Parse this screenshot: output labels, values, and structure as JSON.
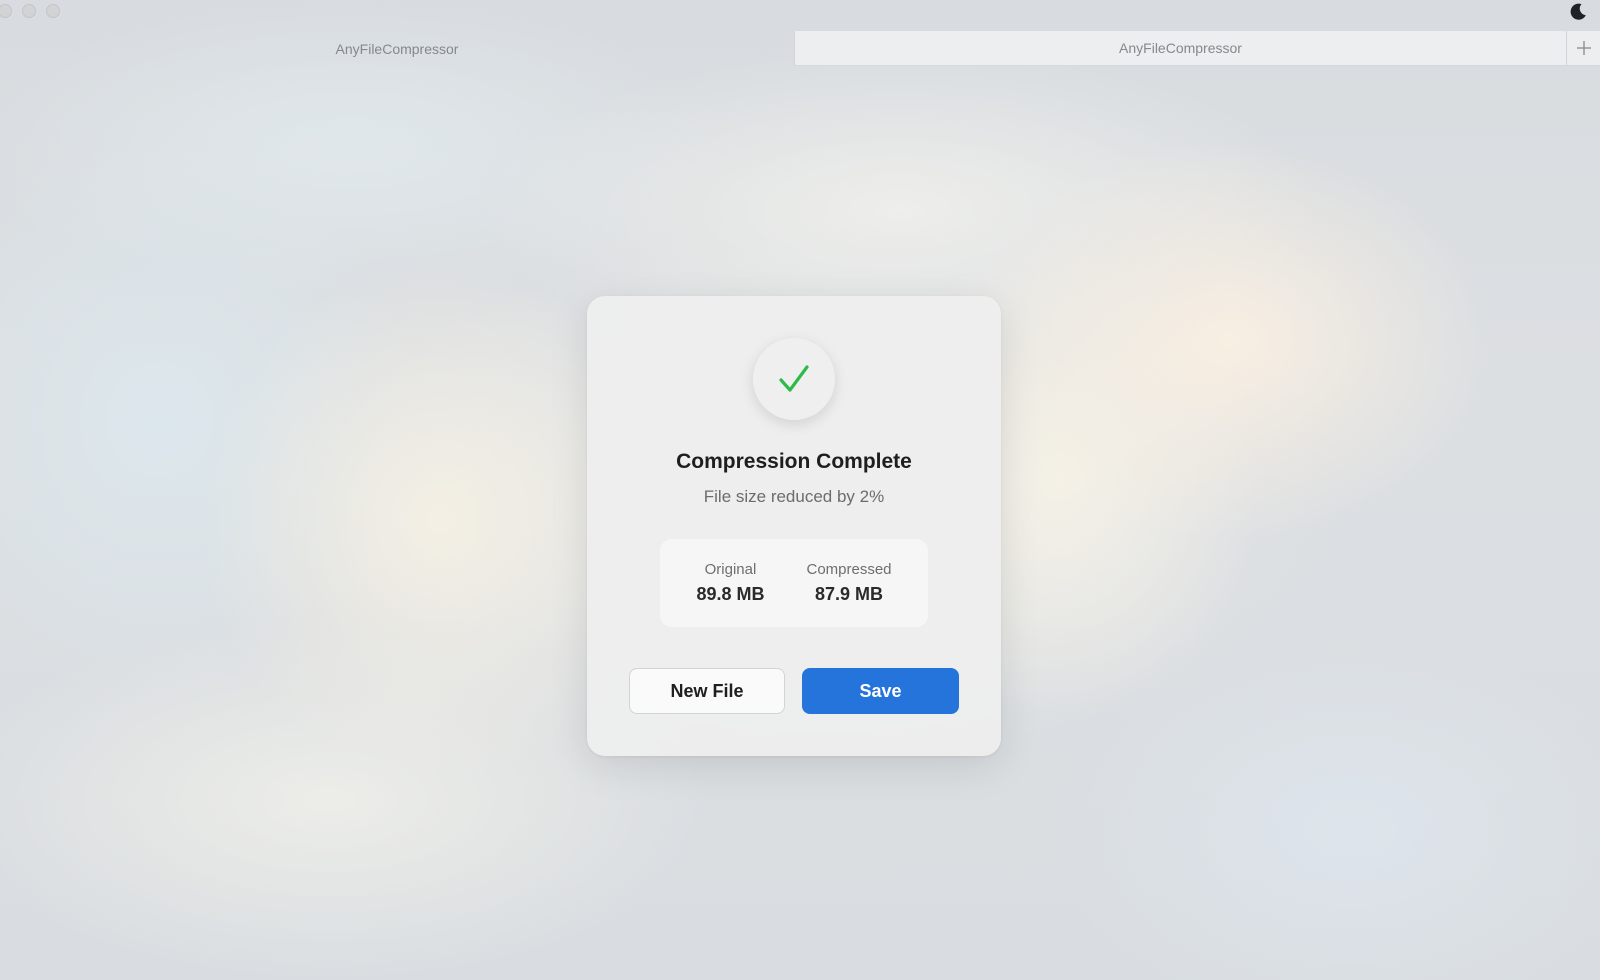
{
  "window": {
    "controls": [
      "close-icon",
      "minimize-icon",
      "zoom-icon"
    ],
    "theme_toggle_icon": "moon-icon"
  },
  "tabs": [
    {
      "label": "AnyFileCompressor",
      "active": false
    },
    {
      "label": "AnyFileCompressor",
      "active": true
    }
  ],
  "new_tab_icon": "plus-icon",
  "dialog": {
    "status_icon": "checkmark-icon",
    "title": "Compression Complete",
    "subtitle": "File size reduced by 2%",
    "original_label": "Original",
    "original_value": "89.8 MB",
    "compressed_label": "Compressed",
    "compressed_value": "87.9 MB",
    "new_file_label": "New File",
    "save_label": "Save"
  },
  "colors": {
    "accent": "#2574dc",
    "success": "#2dbb47"
  }
}
